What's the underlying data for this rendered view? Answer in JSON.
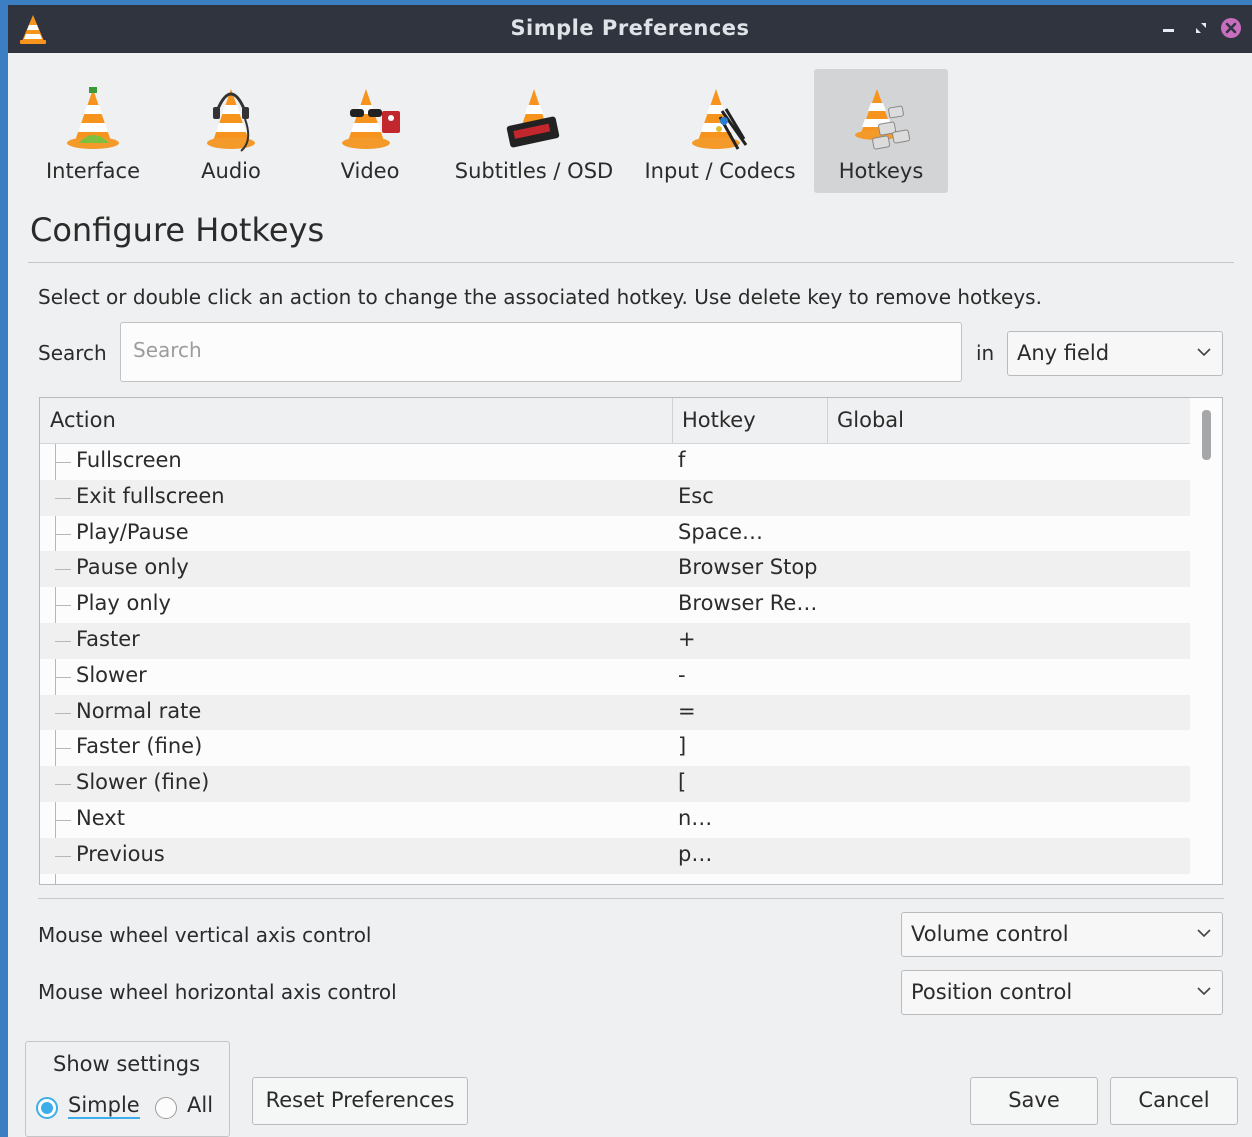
{
  "window": {
    "title": "Simple Preferences"
  },
  "tabs": [
    {
      "label": "Interface"
    },
    {
      "label": "Audio"
    },
    {
      "label": "Video"
    },
    {
      "label": "Subtitles / OSD"
    },
    {
      "label": "Input / Codecs"
    },
    {
      "label": "Hotkeys",
      "active": true
    }
  ],
  "page": {
    "heading": "Configure Hotkeys",
    "description": "Select or double click an action to change the associated hotkey. Use delete key to remove hotkeys."
  },
  "search": {
    "label": "Search",
    "placeholder": "Search",
    "value": "",
    "in_label": "in",
    "field_selected": "Any field"
  },
  "table": {
    "columns": [
      "Action",
      "Hotkey",
      "Global"
    ],
    "rows": [
      {
        "action": "Fullscreen",
        "hotkey": "f",
        "global": ""
      },
      {
        "action": "Exit fullscreen",
        "hotkey": "Esc",
        "global": ""
      },
      {
        "action": "Play/Pause",
        "hotkey": "Space…",
        "global": ""
      },
      {
        "action": "Pause only",
        "hotkey": "Browser Stop",
        "global": ""
      },
      {
        "action": "Play only",
        "hotkey": "Browser Re…",
        "global": ""
      },
      {
        "action": "Faster",
        "hotkey": "+",
        "global": ""
      },
      {
        "action": "Slower",
        "hotkey": "-",
        "global": ""
      },
      {
        "action": "Normal rate",
        "hotkey": "=",
        "global": ""
      },
      {
        "action": "Faster (fine)",
        "hotkey": "]",
        "global": ""
      },
      {
        "action": "Slower (fine)",
        "hotkey": "[",
        "global": ""
      },
      {
        "action": "Next",
        "hotkey": "n…",
        "global": ""
      },
      {
        "action": "Previous",
        "hotkey": "p…",
        "global": ""
      }
    ]
  },
  "mouse": {
    "vertical_label": "Mouse wheel vertical axis control",
    "vertical_value": "Volume control",
    "horizontal_label": "Mouse wheel horizontal axis control",
    "horizontal_value": "Position control"
  },
  "show_settings": {
    "title": "Show settings",
    "simple_label": "Simple",
    "all_label": "All",
    "selected": "Simple"
  },
  "buttons": {
    "reset": "Reset Preferences",
    "save": "Save",
    "cancel": "Cancel"
  },
  "colors": {
    "titlebar": "#2f343f",
    "accent": "#3daee9",
    "close": "#c86ebf"
  }
}
